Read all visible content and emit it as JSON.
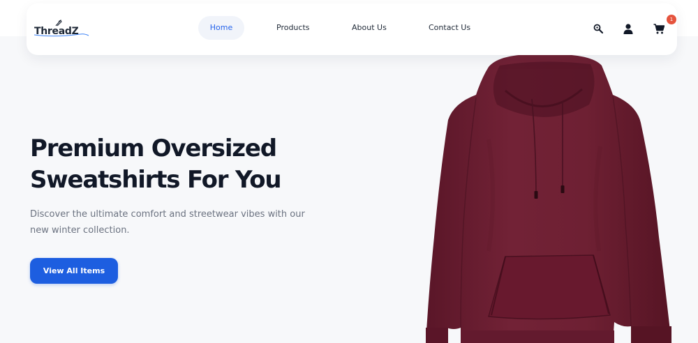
{
  "brand": {
    "name": "ThreadZ"
  },
  "nav": {
    "items": [
      {
        "label": "Home",
        "active": true
      },
      {
        "label": "Products",
        "active": false
      },
      {
        "label": "About Us",
        "active": false
      },
      {
        "label": "Contact Us",
        "active": false
      }
    ]
  },
  "header_icons": {
    "search": "search-icon",
    "account": "user-icon",
    "cart": "cart-icon",
    "cart_count": "1"
  },
  "hero": {
    "title_line1": "Premium Oversized",
    "title_line2": "Sweatshirts For You",
    "description_line1": "Discover the ultimate comfort and streetwear vibes with our",
    "description_line2": "new winter collection.",
    "cta_label": "View All Items",
    "product_color": "#6b1e32"
  },
  "colors": {
    "accent": "#1d5ee0",
    "active_link": "#2563eb",
    "badge": "#e5533d",
    "heading": "#111827",
    "body_text": "#6b7280"
  }
}
